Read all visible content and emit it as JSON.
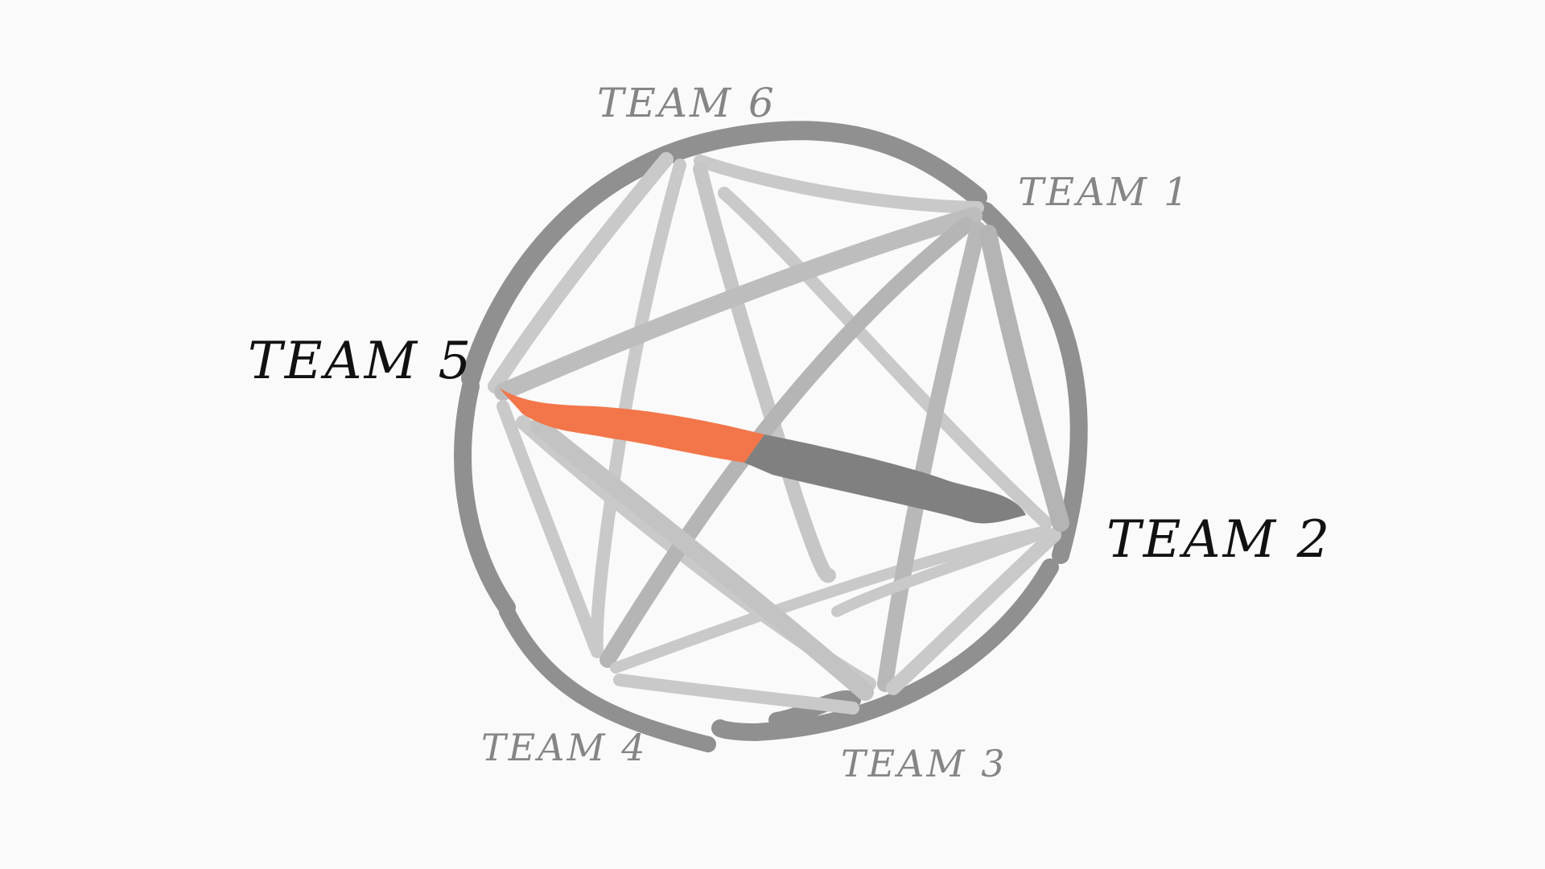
{
  "colors": {
    "background": "#fafafa",
    "ring": "#8f8f8f",
    "link": "#c8c8c8",
    "link_mid": "#b4b4b4",
    "highlight": "#f2764a",
    "highlight_dark": "#7f7f7f",
    "label_muted": "#858585",
    "label_active": "#111111"
  },
  "teams": [
    {
      "id": "team1",
      "label": "TEAM 1",
      "state": "muted"
    },
    {
      "id": "team2",
      "label": "TEAM 2",
      "state": "active"
    },
    {
      "id": "team3",
      "label": "TEAM 3",
      "state": "muted"
    },
    {
      "id": "team4",
      "label": "TEAM 4",
      "state": "muted"
    },
    {
      "id": "team5",
      "label": "TEAM 5",
      "state": "active"
    },
    {
      "id": "team6",
      "label": "TEAM 6",
      "state": "muted"
    }
  ],
  "highlighted_link": {
    "from": "TEAM 5",
    "to": "TEAM 2"
  }
}
